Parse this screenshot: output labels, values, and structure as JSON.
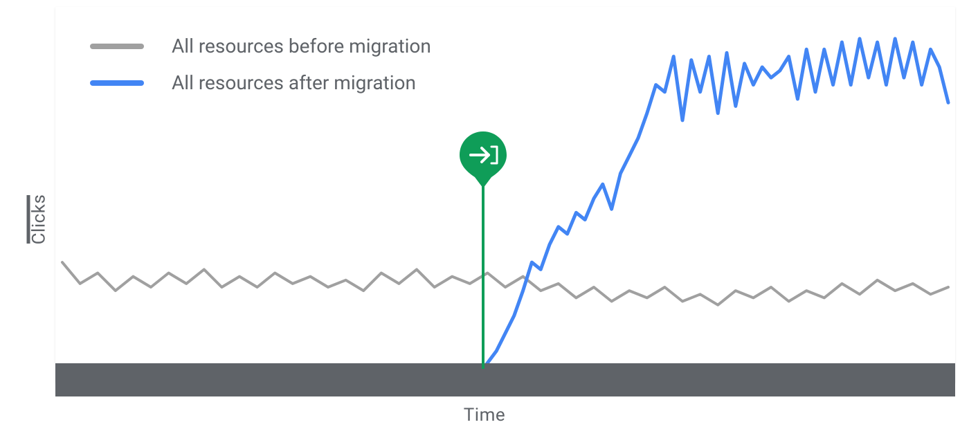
{
  "chart_data": {
    "type": "line",
    "ylabel": "Clicks",
    "xlabel": "Time",
    "migration_point_x": 47.5,
    "xrange": [
      0,
      100
    ],
    "yrange": [
      0,
      100
    ],
    "series": [
      {
        "name": "All resources before migration",
        "color": "#a0a0a0",
        "x": [
          0,
          2,
          4,
          6,
          8,
          10,
          12,
          14,
          16,
          18,
          20,
          22,
          24,
          26,
          28,
          30,
          32,
          34,
          36,
          38,
          40,
          42,
          44,
          46,
          48,
          50,
          52,
          54,
          56,
          58,
          60,
          62,
          64,
          66,
          68,
          70,
          72,
          74,
          76,
          78,
          80,
          82,
          84,
          86,
          88,
          90,
          92,
          94,
          96,
          98,
          100
        ],
        "y": [
          30,
          24,
          27,
          22,
          26,
          23,
          27,
          24,
          28,
          23,
          26,
          23,
          27,
          24,
          26,
          23,
          25,
          22,
          27,
          24,
          28,
          23,
          26,
          24,
          27,
          23,
          26,
          22,
          24,
          20,
          23,
          19,
          22,
          20,
          23,
          19,
          21,
          18,
          22,
          20,
          23,
          19,
          22,
          20,
          24,
          21,
          25,
          22,
          24,
          21,
          23
        ]
      },
      {
        "name": "All resources after migration",
        "color": "#4285f4",
        "x": [
          0,
          47.5,
          49,
          50,
          51,
          52,
          53,
          54,
          55,
          56,
          57,
          58,
          59,
          60,
          61,
          62,
          63,
          64,
          65,
          66,
          67,
          68,
          69,
          70,
          71,
          72,
          73,
          74,
          75,
          76,
          77,
          78,
          79,
          80,
          81,
          82,
          83,
          84,
          85,
          86,
          87,
          88,
          89,
          90,
          91,
          92,
          93,
          94,
          95,
          96,
          97,
          98,
          99,
          100
        ],
        "y": [
          0,
          0,
          5,
          10,
          15,
          22,
          30,
          28,
          35,
          40,
          38,
          44,
          42,
          48,
          52,
          45,
          55,
          60,
          65,
          72,
          80,
          78,
          88,
          70,
          87,
          78,
          88,
          72,
          89,
          74,
          86,
          80,
          85,
          82,
          84,
          88,
          76,
          90,
          78,
          90,
          80,
          92,
          80,
          93,
          82,
          92,
          80,
          93,
          82,
          92,
          80,
          90,
          85,
          75
        ]
      }
    ],
    "legend": {
      "items": [
        {
          "swatch_color": "#a0a0a0",
          "label": "All resources before migration"
        },
        {
          "swatch_color": "#4285f4",
          "label": "All resources after migration"
        }
      ]
    },
    "marker": {
      "color": "#0f9d58",
      "icon": "migrate-arrow",
      "line_color": "#0f9d58"
    }
  }
}
